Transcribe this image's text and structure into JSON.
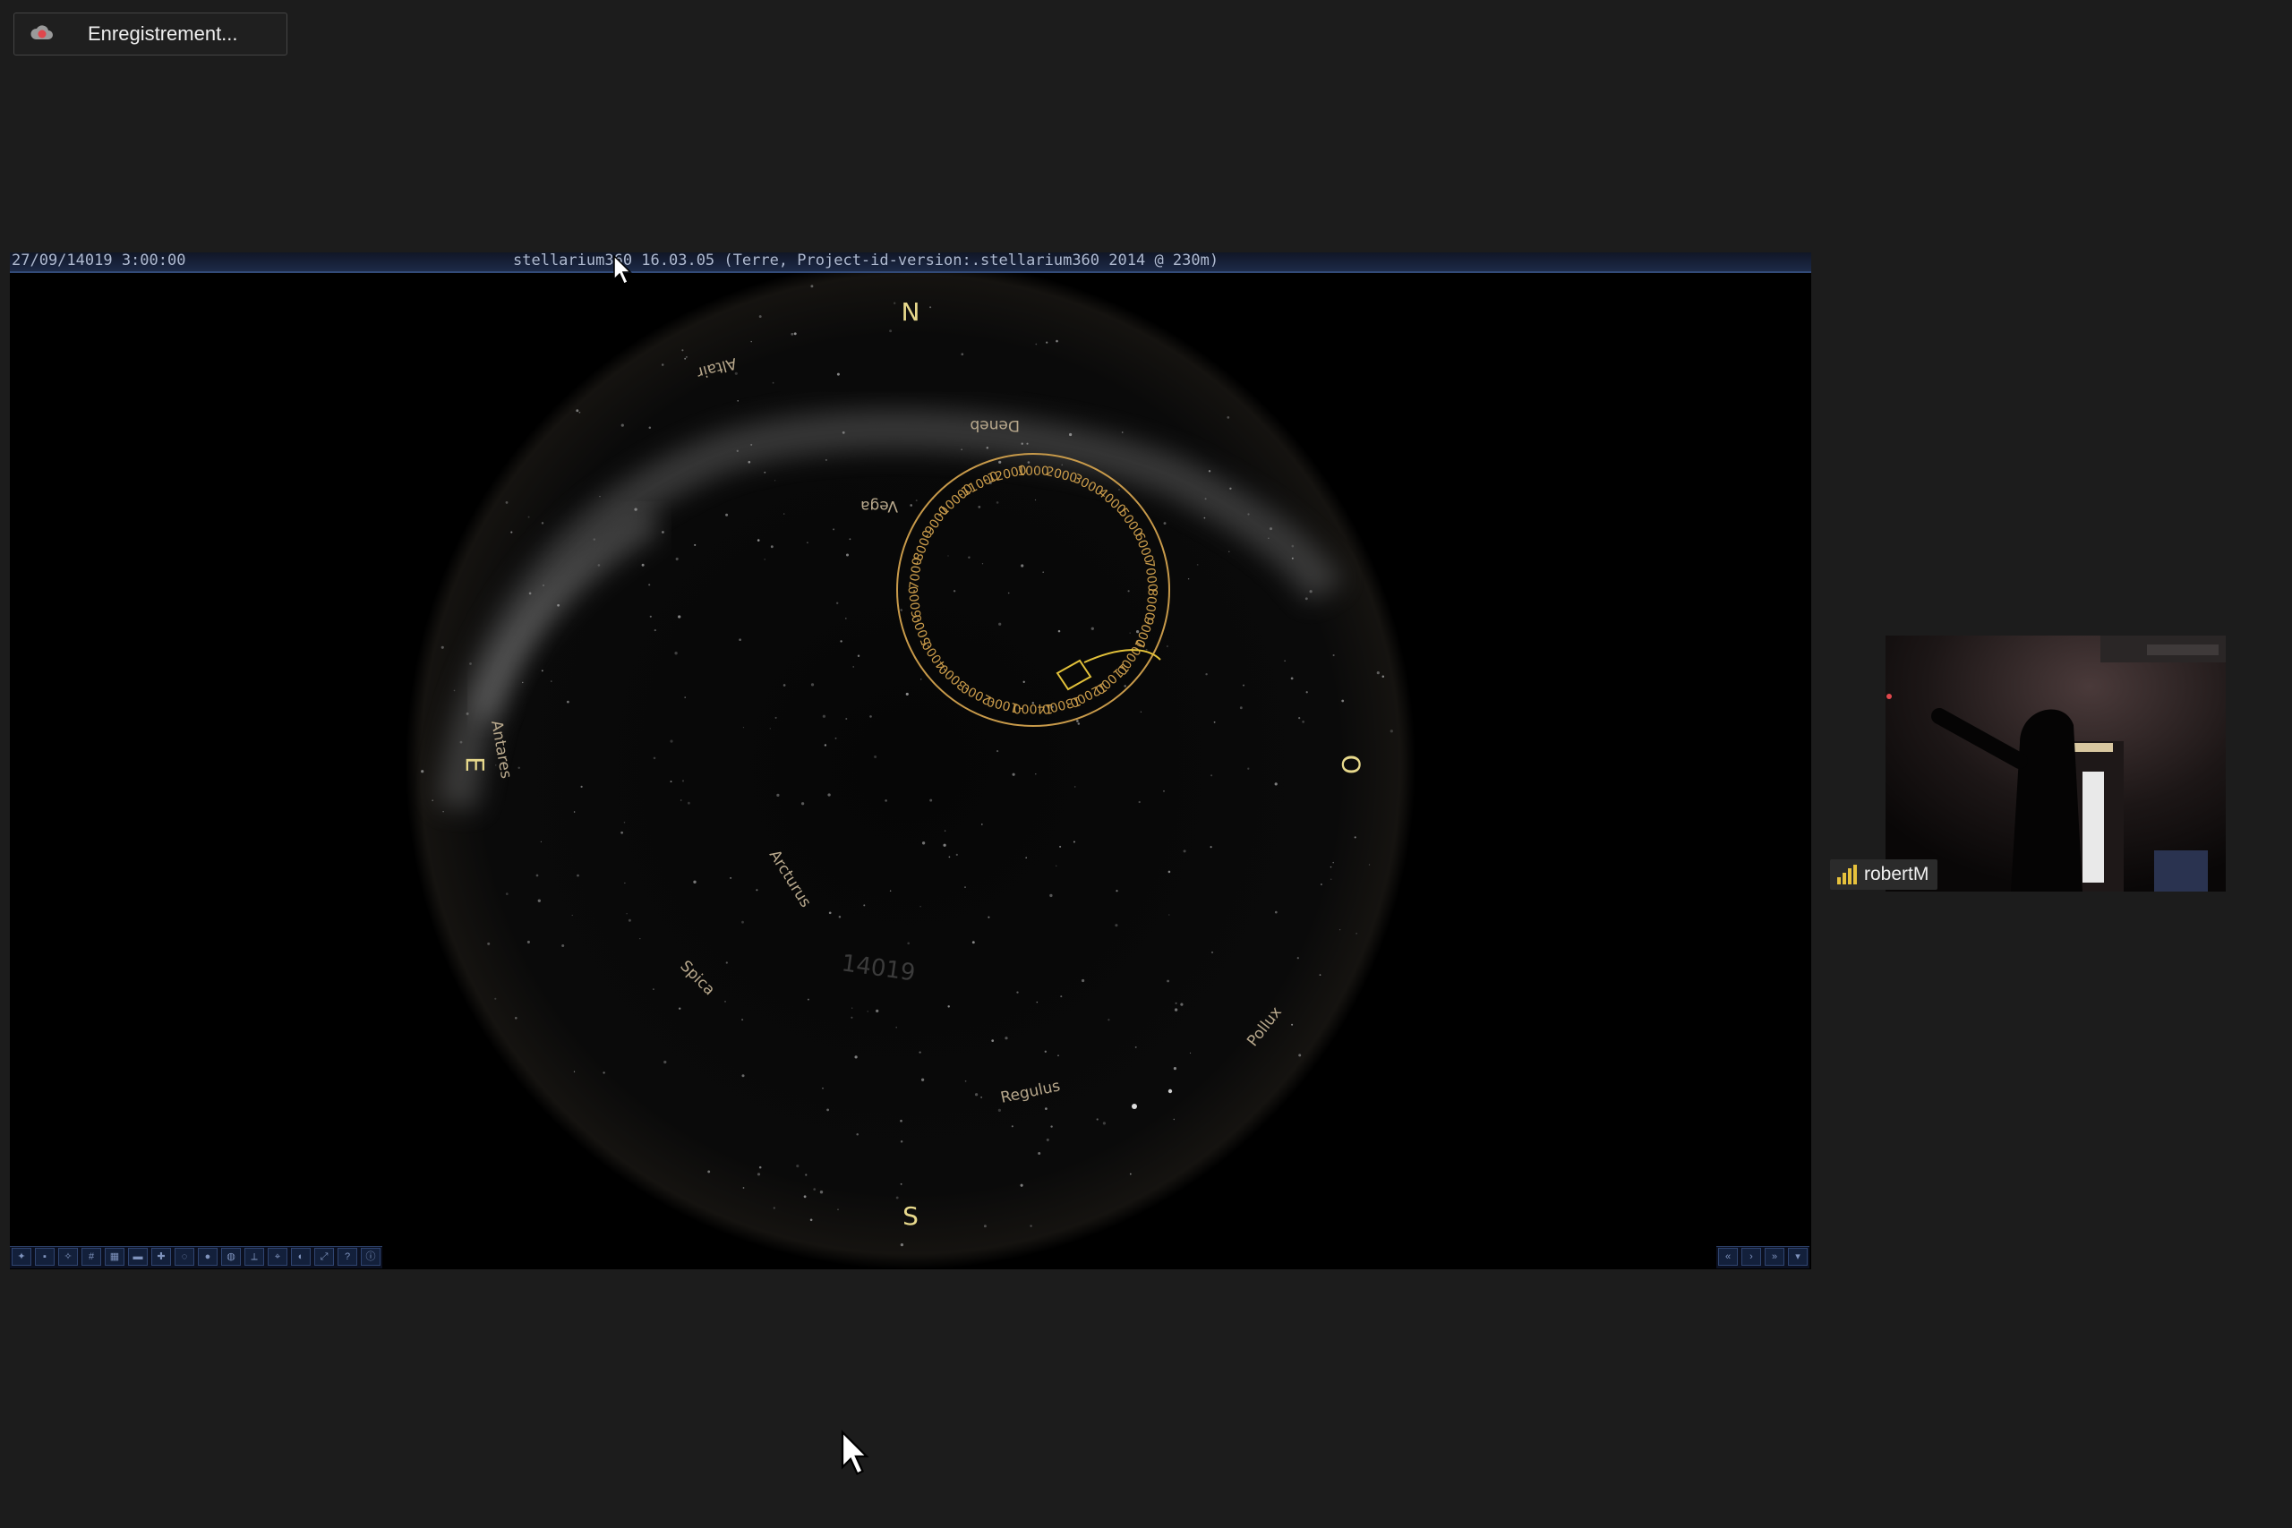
{
  "recording": {
    "label": "Enregistrement...",
    "icon": "record-cloud-icon",
    "accent": "#e0474c"
  },
  "shared_screen": {
    "datetime": "27/09/14019 3:00:00",
    "title": "stellarium360 16.03.05 (Terre, Project-id-version:.stellarium360 2014 @ 230m)",
    "cardinals": {
      "north": "N",
      "south": "S",
      "east": "E",
      "west": "O"
    },
    "stars": [
      "Altair",
      "Deneb",
      "Vega",
      "Antares",
      "Arcturus",
      "Spica",
      "Regulus",
      "Pollux"
    ],
    "year_watermark": "14019",
    "precession_labels": [
      "1000",
      "2000",
      "3000",
      "4000",
      "5000",
      "6000",
      "7000",
      "8000",
      "9000",
      "10000",
      "11000",
      "12000",
      "13000",
      "14000",
      "-1000",
      "-2000",
      "-3000",
      "-4000",
      "-5000",
      "-6000",
      "-7000",
      "-8000",
      "-9000",
      "-10000",
      "-11000",
      "-12000"
    ],
    "line_color": "#c89a4a"
  },
  "participant": {
    "name": "robertM",
    "signal_icon": "signal-bars-icon",
    "signal_color": "#e6c13c"
  }
}
